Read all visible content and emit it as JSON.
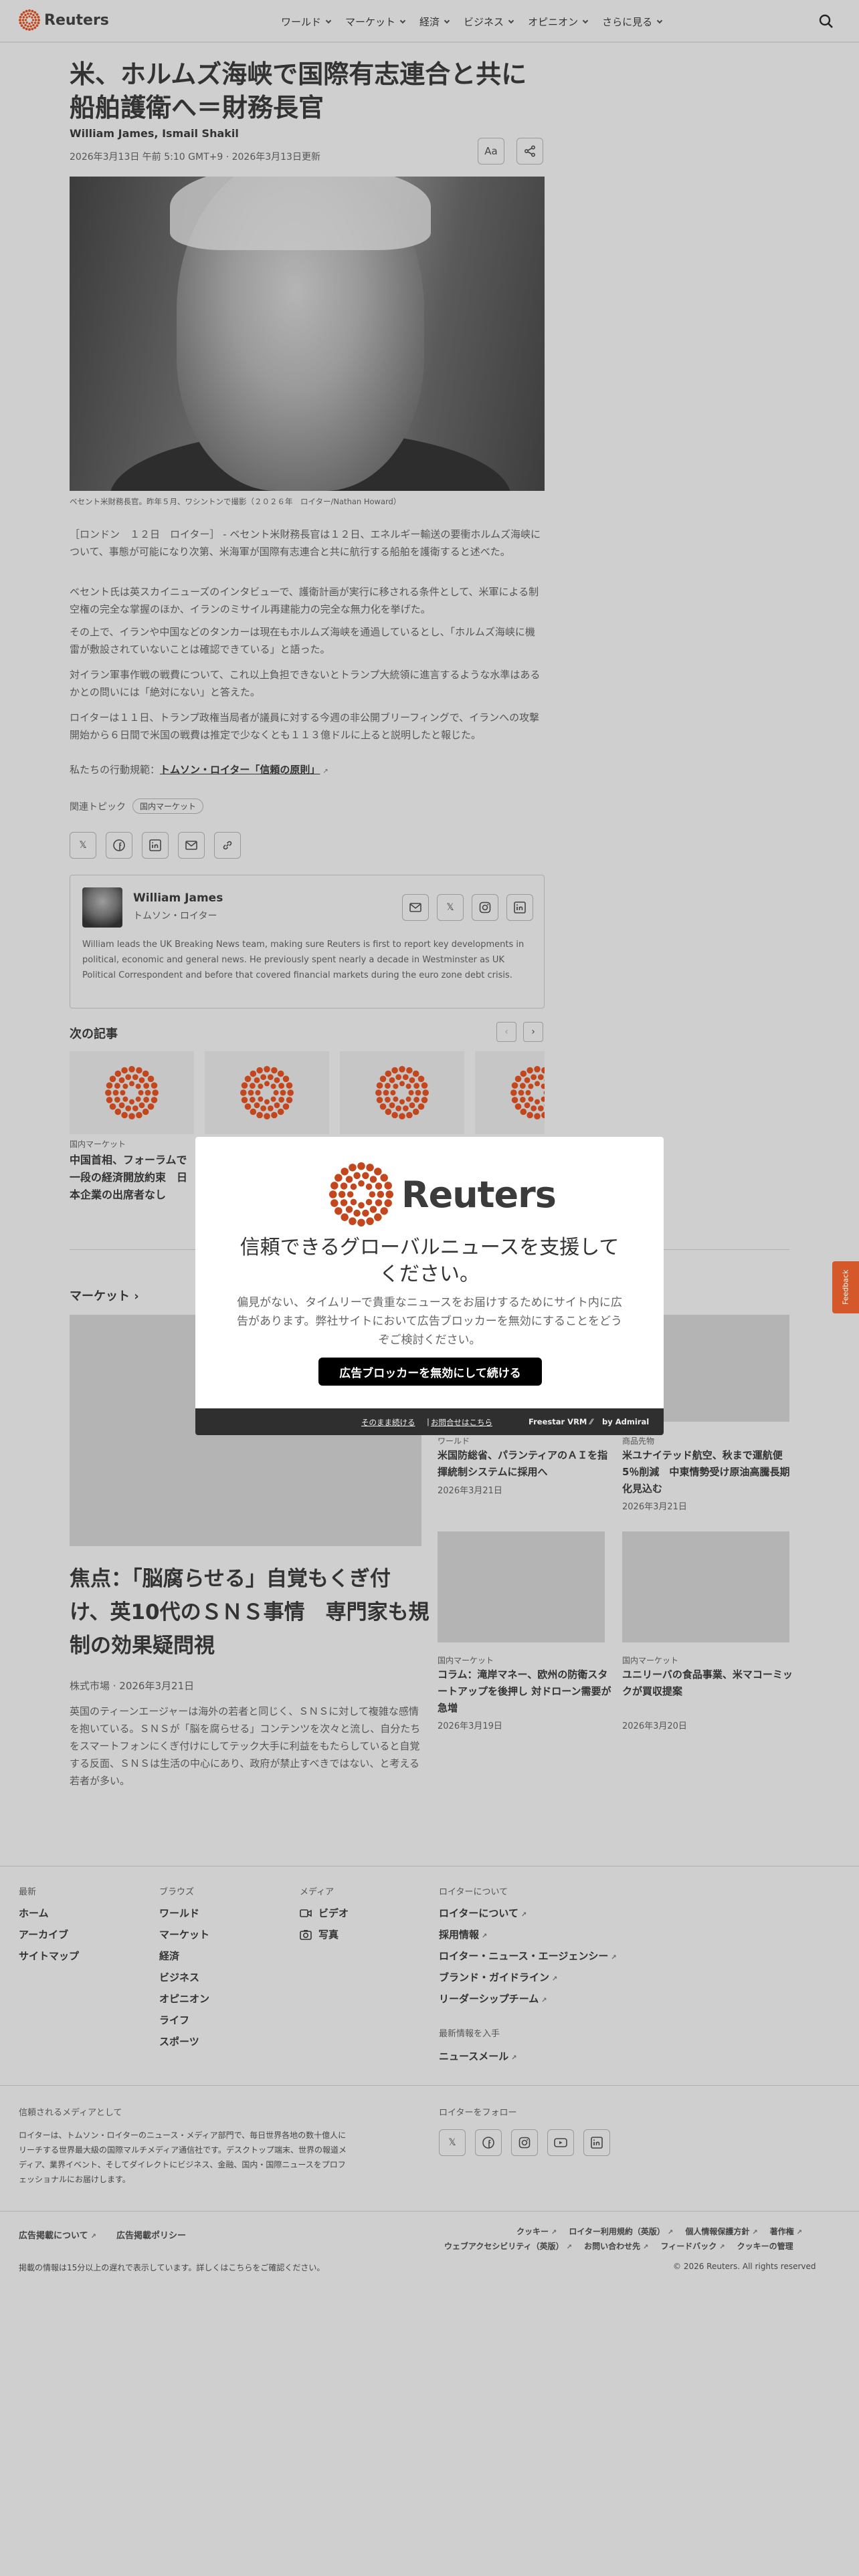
{
  "header": {
    "brand": "Reuters",
    "nav": [
      "ワールド",
      "マーケット",
      "経済",
      "ビジネス",
      "オピニオン",
      "さらに見る"
    ]
  },
  "article": {
    "headline": "米、ホルムズ海峡で国際有志連合と共に船舶護衛へ＝財務長官",
    "authors": "William James, Ismail Shakil",
    "dateline": "2026年3月13日 午前 5:10 GMT+9 · 2026年3月13日更新",
    "font_button": "Aa",
    "photo_caption": "ベセント米財務長官。昨年５月、ワシントンで撮影（２０２６年　ロイター/Nathan Howard）",
    "paragraphs": [
      "［ロンドン　１２日　ロイター］ - ベセント米財務長官は１２日、エネルギー輸送の要衝ホルムズ海峡について、事態が可能になり次第、米海軍が国際有志連合と共に航行する船舶を護衛すると述べた。",
      "ベセント氏は英スカイニューズのインタビューで、護衛計画が実行に移される条件として、米軍による制空権の完全な掌握のほか、イランのミサイル再建能力の完全な無力化を挙げた。",
      "その上で、イランや中国などのタンカーは現在もホルムズ海峡を通過しているとし、「ホルムズ海峡に機雷が敷設されていないことは確認できている」と語った。",
      "対イラン軍事作戦の戦費について、これ以上負担できないとトランプ大統領に進言するような水準はあるかとの問いには「絶対にない」と答えた。",
      "ロイターは１１日、トランプ政権当局者が議員に対する今週の非公開ブリーフィングで、イランへの攻撃開始から６日間で米国の戦費は推定で少なくとも１１３億ドルに上ると説明したと報じた。"
    ],
    "policy_prefix": "私たちの行動規範：",
    "policy_link": "トムソン・ロイター「信頼の原則」",
    "topics_label": "関連トピック",
    "topic": "国内マーケット"
  },
  "author_card": {
    "name": "William James",
    "org": "トムソン・ロイター",
    "bio": "William leads the UK Breaking News team, making sure Reuters is first to report key developments in political, economic and general news. He previously spent nearly a decade in Westminster as UK Political Correspondent and before that covered financial markets during the euro zone debt crisis."
  },
  "next_articles": {
    "title": "次の記事",
    "items": [
      {
        "kicker": "国内マーケット",
        "title": "中国首相、フォーラムで一段の経済開放約束　日本企業の出席者なし"
      }
    ]
  },
  "markets": {
    "title": "マーケット",
    "lead": {
      "title": "焦点：「脳腐らせる」自覚もくぎ付け、英10代のＳＮＳ事情　専門家も規制の効果疑問視",
      "meta": "株式市場 · 2026年3月21日",
      "desc": "英国のティーンエージャーは海外の若者と同じく、ＳＮＳに対して複雑な感情を抱いている。ＳＮＳが「脳を腐らせる」コンテンツを次々と流し、自分たちをスマートフォンにくぎ付けにしてテック大手に利益をもたらしていると自覚する反面、ＳＮＳは生活の中心にあり、政府が禁止すべきではない、と考える若者が多い。"
    },
    "items": [
      {
        "kicker": "ワールド",
        "title": "米国防総省、パランティアのＡＩを指揮統制システムに採用へ",
        "date": "2026年3月21日"
      },
      {
        "kicker": "商品先物",
        "title": "米ユナイテッド航空、秋まで運航便5％削減　中東情勢受け原油高騰長期化見込む",
        "date": "2026年3月21日"
      },
      {
        "kicker": "国内マーケット",
        "title": "コラム：滝岸マネー、欧州の防衛スタートアップを後押し 対ドローン需要が急増",
        "date": "2026年3月19日"
      },
      {
        "kicker": "国内マーケット",
        "title": "ユニリーバの食品事業、米マコーミックが買収提案",
        "date": "2026年3月20日"
      }
    ]
  },
  "footer": {
    "col1": {
      "head": "最新",
      "links": [
        "ホーム",
        "アーカイブ",
        "サイトマップ"
      ]
    },
    "col2": {
      "head": "ブラウズ",
      "links": [
        "ワールド",
        "マーケット",
        "経済",
        "ビジネス",
        "オピニオン",
        "ライフ",
        "スポーツ"
      ]
    },
    "col3": {
      "head": "メディア",
      "links": [
        "ビデオ",
        "写真"
      ]
    },
    "col4": {
      "head": "ロイターについて",
      "links": [
        "ロイターについて",
        "採用情報",
        "ロイター・ニュース・エージェンシー",
        "ブランド・ガイドライン",
        "リーダーシップチーム"
      ]
    },
    "col4b": {
      "head": "最新情報を入手",
      "links": [
        "ニュースメール"
      ]
    },
    "trusted_head": "信頼されるメディアとして",
    "trusted_text": "ロイターは、トムソン・ロイターのニュース・メディア部門で、毎日世界各地の数十億人にリーチする世界最大級の国際マルチメディア通信社です。デスクトップ端末、世界の報道メディア、業界イベント、そしてダイレクトにビジネス、金融、国内・国際ニュースをプロフェッショナルにお届けします。",
    "follow_head": "ロイターをフォロー",
    "legal_left": [
      "広告掲載について",
      "広告掲載ポリシー"
    ],
    "legal_right_1": [
      "クッキー",
      "ロイター利用規約（英版）",
      "個人情報保護方針",
      "著作権"
    ],
    "legal_right_2": [
      "ウェブアクセシビリティ（英版）",
      "お問い合わせ先",
      "フィードバック",
      "クッキーの管理"
    ],
    "disclaimer": "掲載の情報は15分以上の遅れで表示しています。詳しくはこちらをご確認ください。",
    "copyright": "© 2026 Reuters. All rights reserved"
  },
  "modal": {
    "brand": "Reuters",
    "title": "信頼できるグローバルニュースを支援してください。",
    "text": "偏見がない、タイムリーで貴重なニュースをお届けするためにサイト内に広告があります。弊社サイトにおいて広告ブロッカーを無効にすることをどうぞご検討ください。",
    "button": "広告ブロッカーを無効にして続ける",
    "foot_continue": "そのまま続ける",
    "foot_contact": "お問合せはこちら",
    "foot_brand": "Freestar VRM",
    "foot_by": "by Admiral"
  },
  "feedback": "Feedback",
  "colors": {
    "accent": "#d4582a",
    "dots": "#c3461c"
  }
}
